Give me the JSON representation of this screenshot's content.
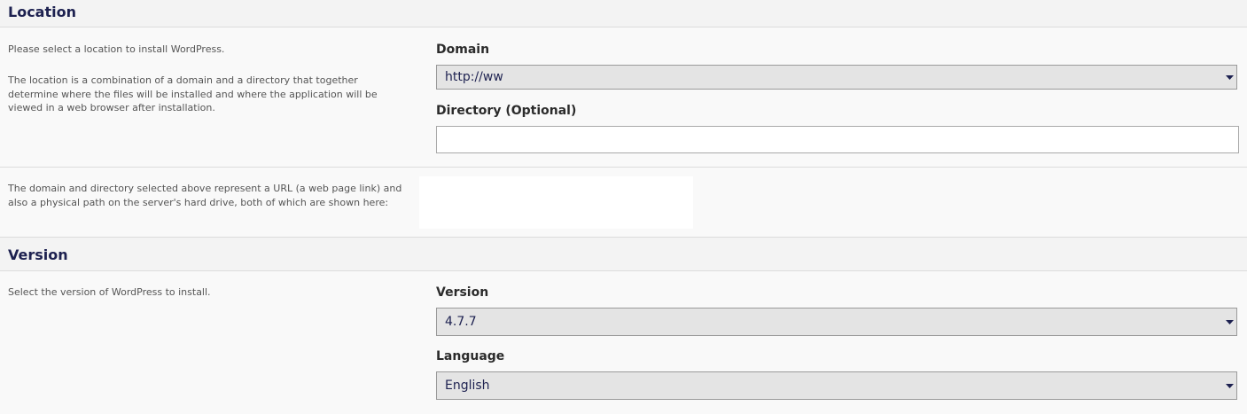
{
  "location": {
    "heading": "Location",
    "help_1": "Please select a location to install WordPress.",
    "help_2": "The location is a combination of a domain and a directory that together determine where the files will be installed and where the application will be viewed in a web browser after installation.",
    "domain_label": "Domain",
    "domain_value": "http://ww",
    "directory_label": "Directory (Optional)",
    "directory_value": "",
    "path_help": "The domain and directory selected above represent a URL (a web page link) and also a physical path on the server's hard drive, both of which are shown here:"
  },
  "version": {
    "heading": "Version",
    "help": "Select the version of WordPress to install.",
    "version_label": "Version",
    "version_value": "4.7.7",
    "language_label": "Language",
    "language_value": "English"
  },
  "colors": {
    "heading": "#1d2150",
    "select_bg": "#e4e4e4",
    "arrow": "#1d2150"
  },
  "icons": {
    "select_arrow": "chevron-down-icon"
  }
}
